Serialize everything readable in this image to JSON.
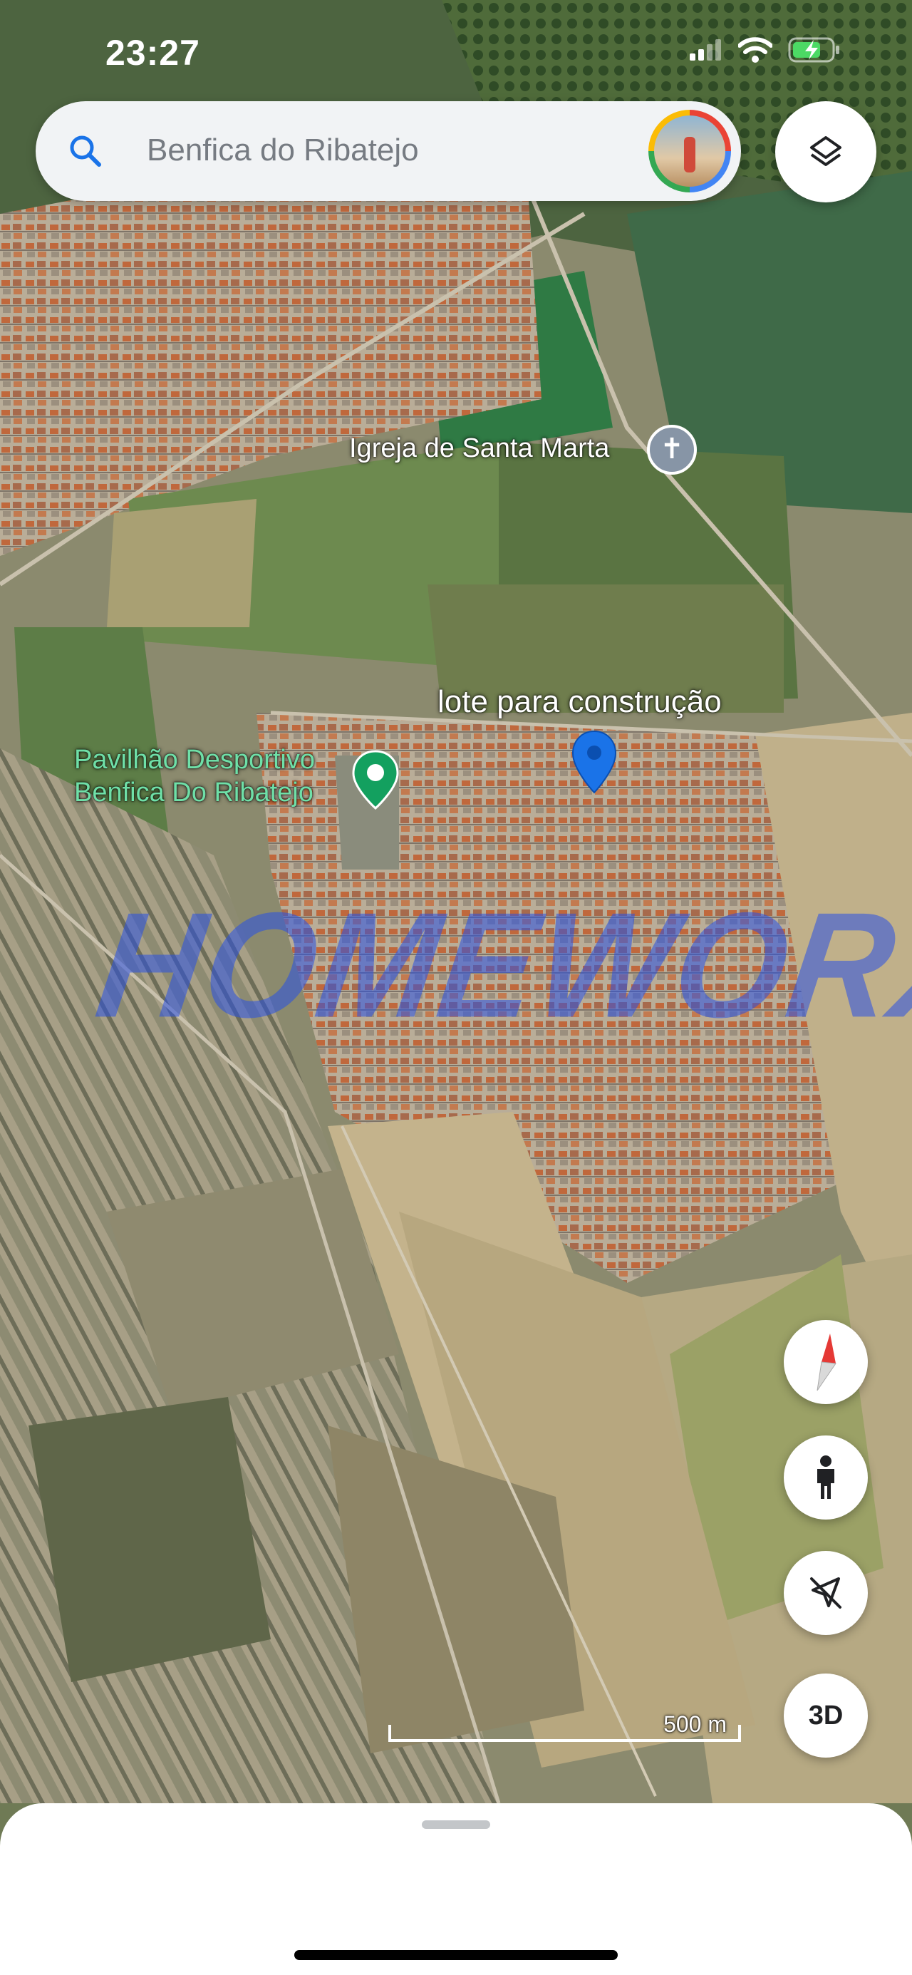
{
  "status_bar": {
    "time": "23:27"
  },
  "search": {
    "placeholder": "Benfica do Ribatejo"
  },
  "map": {
    "view": "satellite",
    "labels": {
      "church": "Igreja de Santa Marta",
      "pin": "lote para construção",
      "pavilion_line1": "Pavilhão Desportivo",
      "pavilion_line2": "Benfica Do Ribatejo"
    },
    "watermark": "HOMEWORX",
    "scale_label": "500 m"
  },
  "controls": {
    "three_d_label": "3D"
  },
  "colors": {
    "pin": "#1a73e8",
    "poi_green": "#13a05f",
    "watermark": "#2850e6"
  }
}
